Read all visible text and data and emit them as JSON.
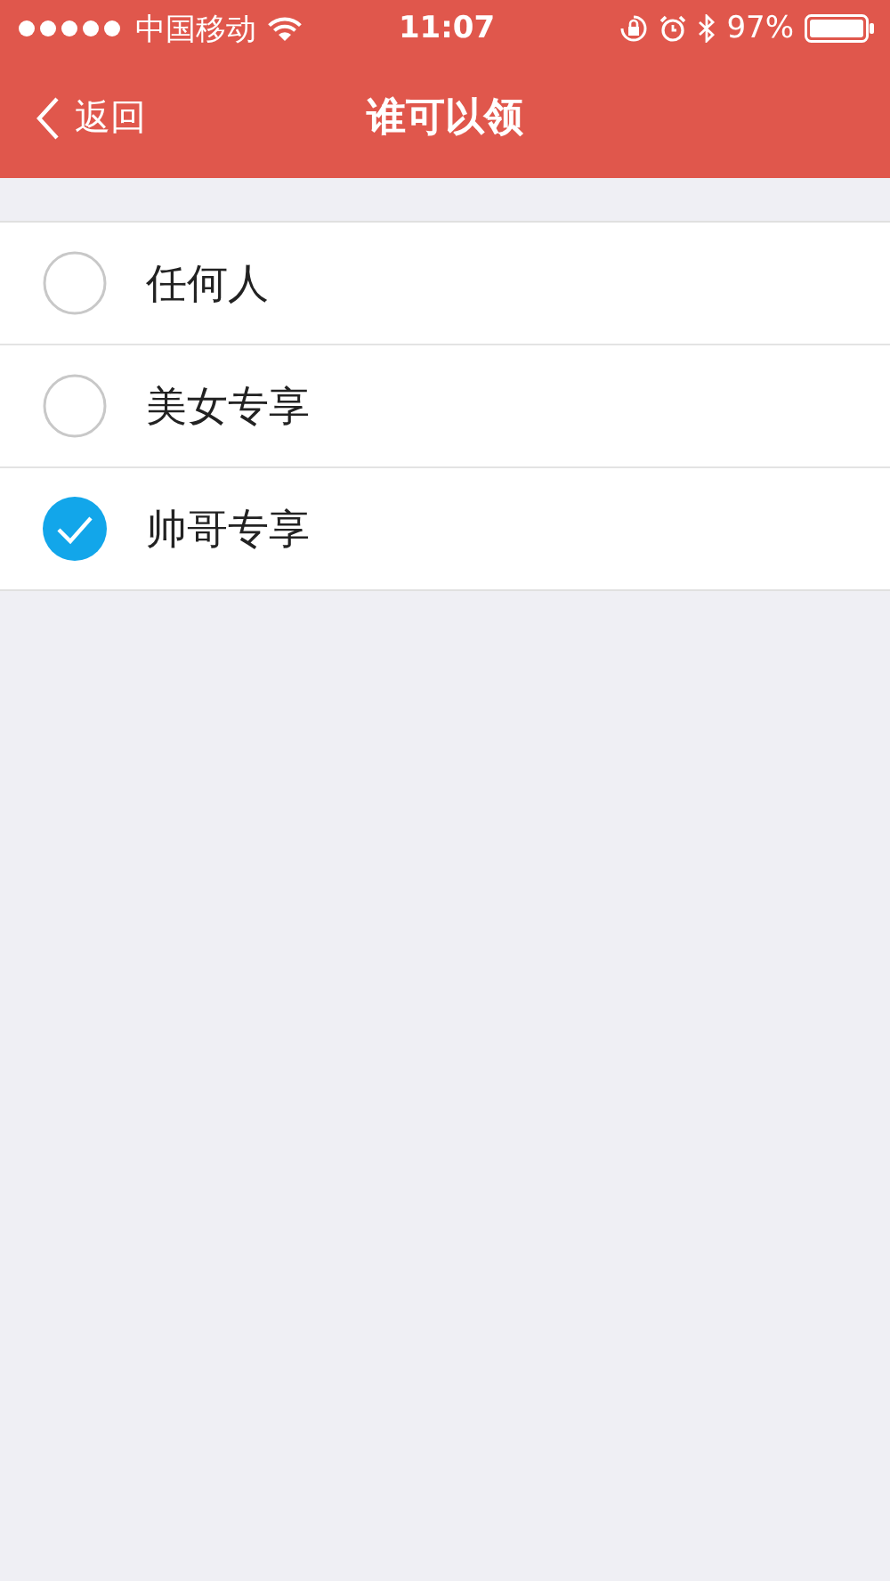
{
  "status_bar": {
    "carrier": "中国移动",
    "time": "11:07",
    "battery": "97%"
  },
  "nav": {
    "back": "返回",
    "title": "谁可以领"
  },
  "options": [
    {
      "label": "任何人",
      "selected": false
    },
    {
      "label": "美女专享",
      "selected": false
    },
    {
      "label": "帅哥专享",
      "selected": true
    }
  ]
}
